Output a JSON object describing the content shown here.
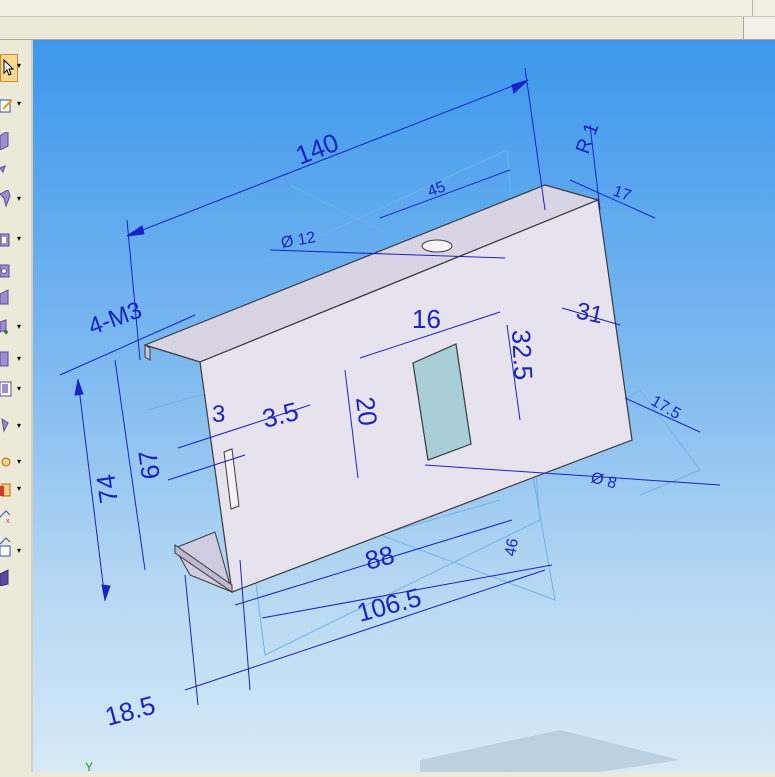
{
  "colors": {
    "viewport_top": "#3c97ec",
    "viewport_bottom": "#d7e9f6",
    "dimension_color": "#1a22c8",
    "part_face": "#e6e2ee",
    "part_edge": "#3a3a3a",
    "window_fill": "#a8cfd8",
    "toolbar_bg": "#ece9d8"
  },
  "toolbar": {
    "items": [
      {
        "name": "select-arrow-icon",
        "active": true
      },
      {
        "name": "sketch-icon"
      },
      {
        "name": "extrude-icon"
      },
      {
        "name": "revolve-icon"
      },
      {
        "name": "sweep-icon"
      },
      {
        "name": "flange-icon"
      },
      {
        "name": "hole-icon"
      },
      {
        "name": "cut-icon"
      },
      {
        "name": "feature-icon"
      },
      {
        "name": "shell-icon"
      },
      {
        "name": "pattern-icon"
      },
      {
        "name": "rib-icon"
      },
      {
        "name": "draft-icon"
      },
      {
        "name": "round-icon"
      },
      {
        "name": "chamfer-icon"
      },
      {
        "name": "mirror-icon"
      },
      {
        "name": "plane-icon"
      },
      {
        "name": "body-icon"
      }
    ]
  },
  "dimensions": {
    "d140": "140",
    "d45": "45",
    "r1": "R 1",
    "d17": "17",
    "dia12": "Ø 12",
    "thread": "4-M3",
    "d16": "16",
    "d31": "31",
    "d32_5": "32.5",
    "d3": "3",
    "d3_5": "3.5",
    "d20": "20",
    "d67": "67",
    "d74": "74",
    "d17_5": "17.5",
    "dia8": "Ø 8",
    "d88": "88",
    "d46": "46",
    "d106_5": "106.5",
    "d18_5": "18.5"
  },
  "axis": {
    "y_label": "Y"
  }
}
